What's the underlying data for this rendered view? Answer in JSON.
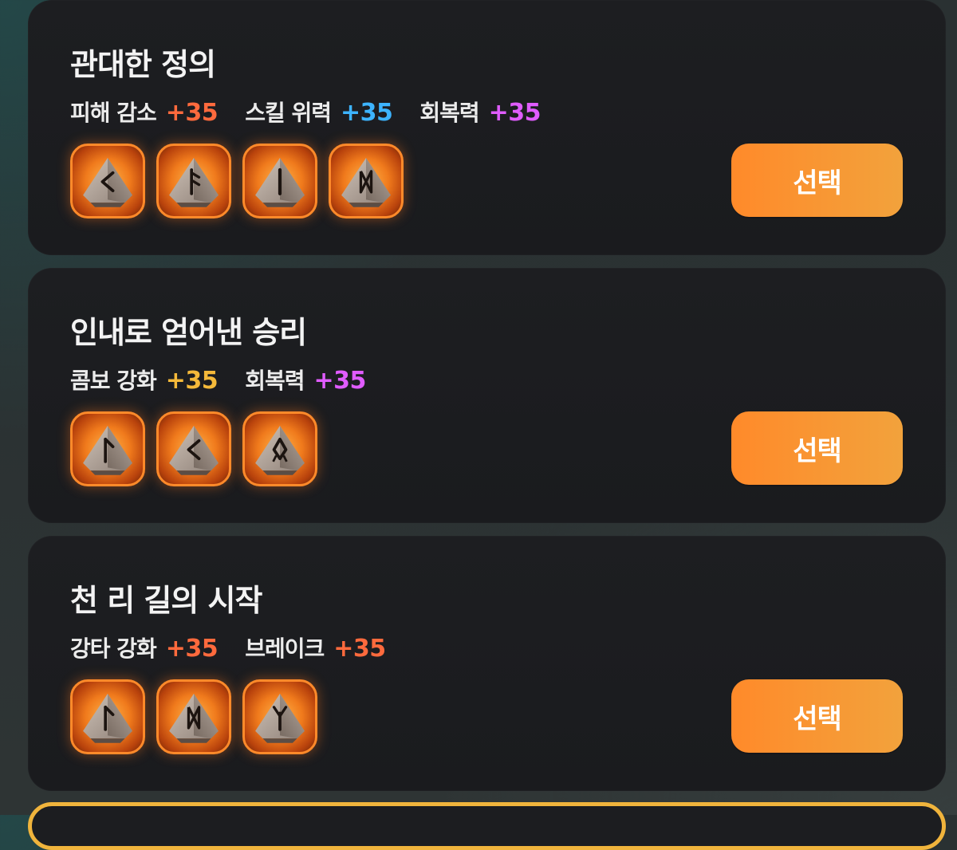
{
  "colors": {
    "orange": "#ff6a3d",
    "blue": "#3db4ff",
    "purple": "#e05cff",
    "gold": "#f5b93a",
    "button": "#ff8a2a"
  },
  "cards": [
    {
      "title": "관대한 정의",
      "stats": [
        {
          "label": "피해 감소",
          "value": "+35",
          "color": "#ff6a3d"
        },
        {
          "label": "스킬 위력",
          "value": "+35",
          "color": "#3db4ff"
        },
        {
          "label": "회복력",
          "value": "+35",
          "color": "#e05cff"
        }
      ],
      "runes": [
        {
          "icon": "rune-kaun-icon"
        },
        {
          "icon": "rune-ansuz-icon"
        },
        {
          "icon": "rune-isa-icon"
        },
        {
          "icon": "rune-dagaz-icon"
        }
      ],
      "button": "선택"
    },
    {
      "title": "인내로 얻어낸 승리",
      "stats": [
        {
          "label": "콤보 강화",
          "value": "+35",
          "color": "#f5b93a"
        },
        {
          "label": "회복력",
          "value": "+35",
          "color": "#e05cff"
        }
      ],
      "runes": [
        {
          "icon": "rune-laguz-icon"
        },
        {
          "icon": "rune-kaun-icon"
        },
        {
          "icon": "rune-othala-icon"
        }
      ],
      "button": "선택"
    },
    {
      "title": "천 리 길의 시작",
      "stats": [
        {
          "label": "강타 강화",
          "value": "+35",
          "color": "#ff6a3d"
        },
        {
          "label": "브레이크",
          "value": "+35",
          "color": "#ff6a3d"
        }
      ],
      "runes": [
        {
          "icon": "rune-laguz-icon"
        },
        {
          "icon": "rune-dagaz-icon"
        },
        {
          "icon": "rune-algiz-icon"
        }
      ],
      "button": "선택"
    }
  ]
}
